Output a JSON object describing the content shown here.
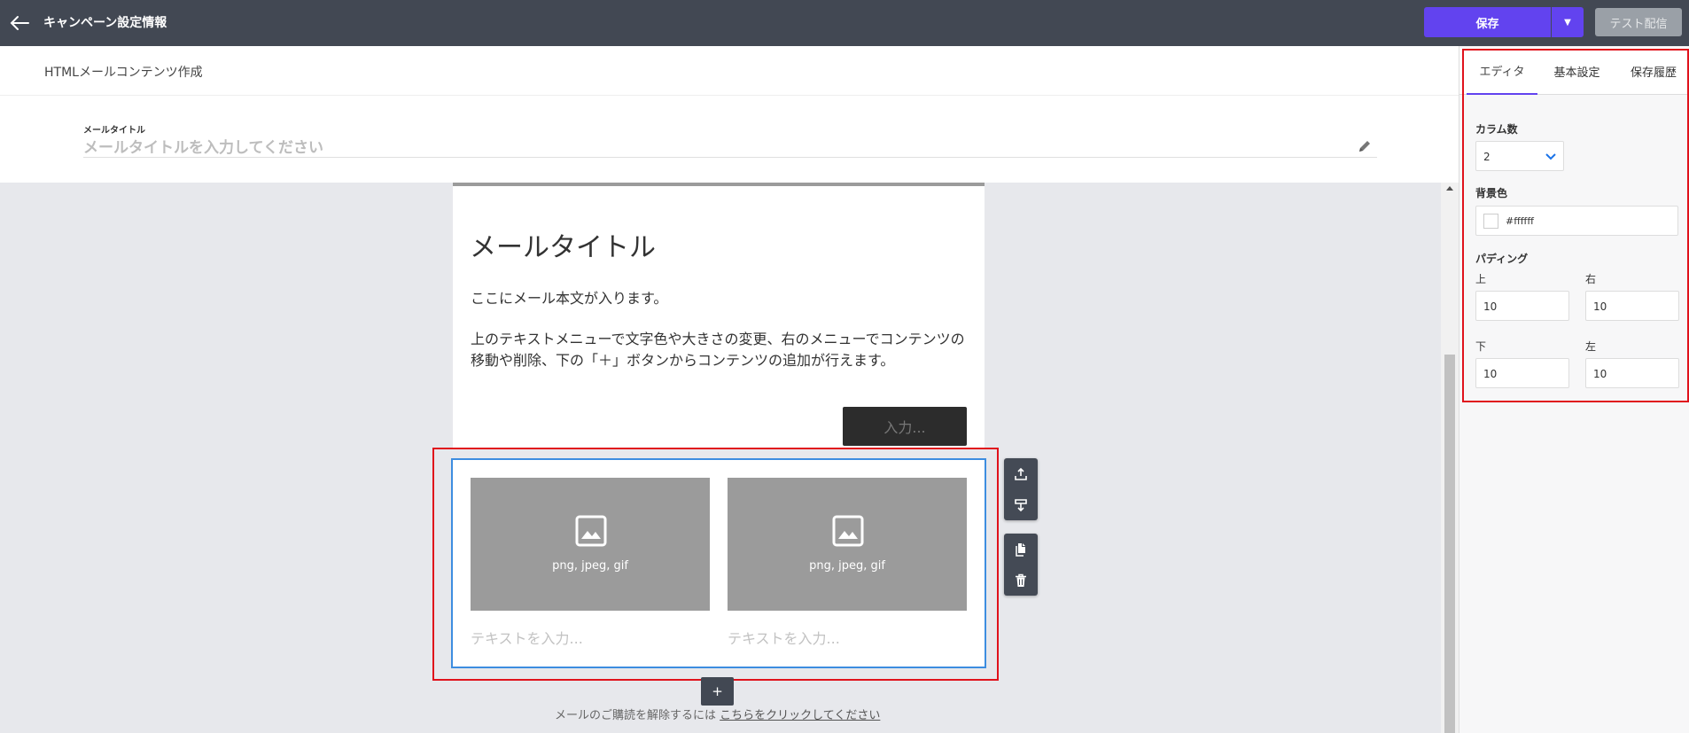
{
  "header": {
    "title": "キャンペーン設定情報",
    "save_label": "保存",
    "test_label": "テスト配信"
  },
  "subheader": {
    "title": "HTMLメールコンテンツ作成"
  },
  "mail_title": {
    "label": "メールタイトル",
    "placeholder": "メールタイトルを入力してください"
  },
  "card": {
    "heading": "メールタイトル",
    "body1": "ここにメール本文が入ります。",
    "body2": "上のテキストメニューで文字色や大きさの変更、右のメニューでコンテンツの移動や削除、下の「＋」ボタンからコンテンツの追加が行えます。",
    "button_label": "入力..."
  },
  "block": {
    "columns": [
      {
        "image_text": "png, jpeg, gif",
        "text_placeholder": "テキストを入力..."
      },
      {
        "image_text": "png, jpeg, gif",
        "text_placeholder": "テキストを入力..."
      }
    ]
  },
  "add_label": "+",
  "footer": {
    "unsubscribe_text": "メールのご購読を解除するには ",
    "unsubscribe_link": "こちらをクリックしてください"
  },
  "panel": {
    "tabs": [
      "エディタ",
      "基本設定",
      "保存履歴"
    ],
    "columns_label": "カラム数",
    "columns_value": "2",
    "bg_label": "背景色",
    "bg_value": "#ffffff",
    "padding_label": "パディング",
    "padding": {
      "top_label": "上",
      "top": "10",
      "right_label": "右",
      "right": "10",
      "bottom_label": "下",
      "bottom": "10",
      "left_label": "左",
      "left": "10"
    }
  },
  "colors": {
    "topbar": "#424853",
    "accent": "#6243ef",
    "selection": "#e0121c",
    "block_border": "#3d8de0"
  },
  "icons": [
    "back-arrow-icon",
    "dropdown-caret-icon",
    "pencil-icon",
    "image-icon",
    "move-up-icon",
    "move-down-icon",
    "copy-icon",
    "trash-icon",
    "chevron-down-icon"
  ]
}
